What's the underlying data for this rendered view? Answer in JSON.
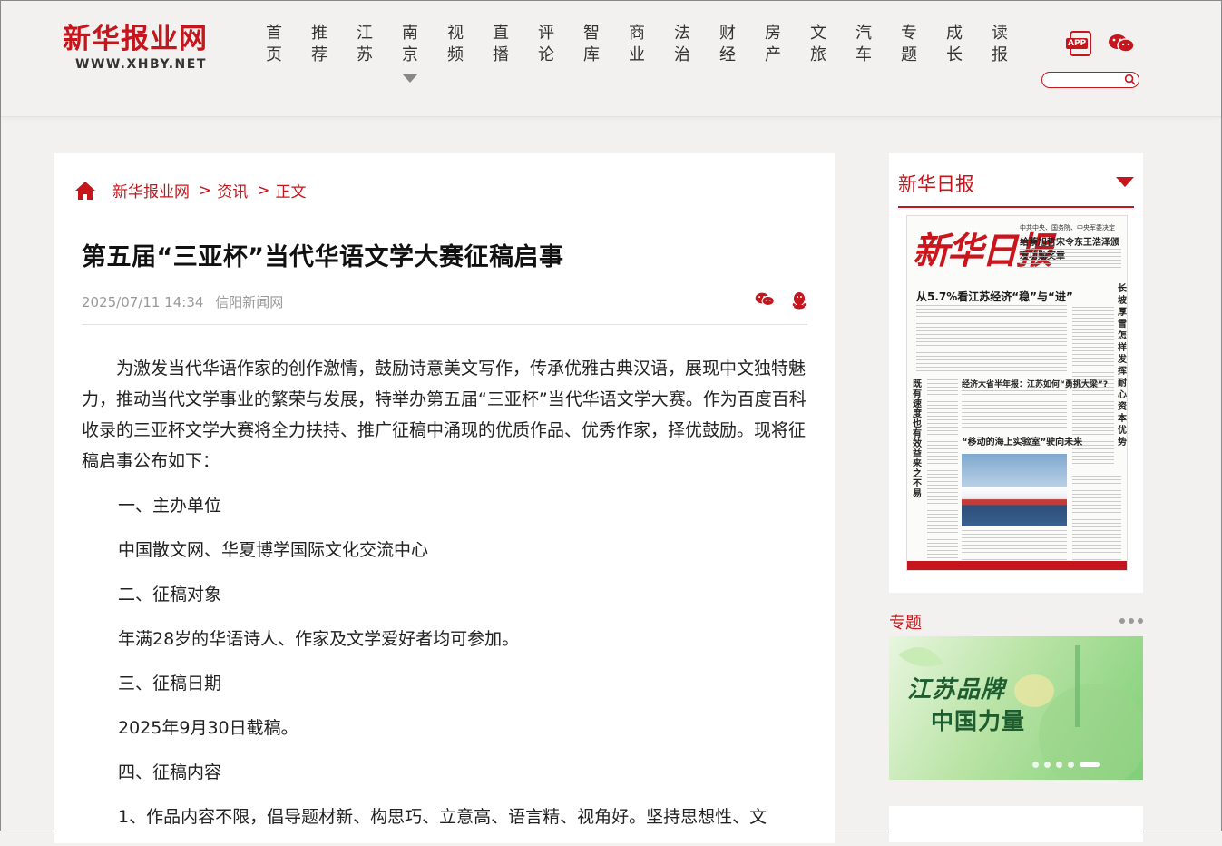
{
  "site": {
    "logo_cn": "新华报业网",
    "logo_en": "WWW.XHBY.NET"
  },
  "nav": [
    {
      "c1": "首",
      "c2": "页"
    },
    {
      "c1": "推",
      "c2": "荐"
    },
    {
      "c1": "江",
      "c2": "苏"
    },
    {
      "c1": "南",
      "c2": "京"
    },
    {
      "c1": "视",
      "c2": "频"
    },
    {
      "c1": "直",
      "c2": "播"
    },
    {
      "c1": "评",
      "c2": "论"
    },
    {
      "c1": "智",
      "c2": "库"
    },
    {
      "c1": "商",
      "c2": "业"
    },
    {
      "c1": "法",
      "c2": "治"
    },
    {
      "c1": "财",
      "c2": "经"
    },
    {
      "c1": "房",
      "c2": "产"
    },
    {
      "c1": "文",
      "c2": "旅"
    },
    {
      "c1": "汽",
      "c2": "车"
    },
    {
      "c1": "专",
      "c2": "题"
    },
    {
      "c1": "成",
      "c2": "长"
    },
    {
      "c1": "读",
      "c2": "报"
    }
  ],
  "header_icons": {
    "app_label": "APP"
  },
  "breadcrumb": {
    "home": "新华报业网",
    "sep1": ">",
    "section": "资讯",
    "sep2": ">",
    "current": "正文"
  },
  "article": {
    "title": "第五届“三亚杯”当代华语文学大赛征稿启事",
    "date": "2025/07/11 14:34",
    "source": "信阳新闻网",
    "intro": "为激发当代华语作家的创作激情，鼓励诗意美文写作，传承优雅古典汉语，展现中文独特魅力，推动当代文学事业的繁荣与发展，特举办第五届“三亚杯”当代华语文学大赛。作为百度百科收录的三亚杯文学大赛将全力扶持、推广征稿中涌现的优质作品、优秀作家，择优鼓励。现将征稿启事公布如下：",
    "s1_head": "一、主办单位",
    "s1_body": "中国散文网、华夏博学国际文化交流中心",
    "s2_head": "二、征稿对象",
    "s2_body": "年满28岁的华语诗人、作家及文学爱好者均可参加。",
    "s3_head": "三、征稿日期",
    "s3_body": "2025年9月30日截稿。",
    "s4_head": "四、征稿内容",
    "s4_body": "1、作品内容不限，倡导题材新、构思巧、立意高、语言精、视角好。坚持思想性、文"
  },
  "sidebar": {
    "paper_title": "新华日报",
    "paper": {
      "masthead": "新华日报",
      "top_line": "中共中央、国务院、中央军委决定",
      "top_head": "给蔡旭哲宋令东王浩泽颁发功勋奖章",
      "headline": "从5.7%看江苏经济“稳”与“进”",
      "mid_head": "经济大省半年报：江苏如何“勇挑大梁”?",
      "ship_head": "“移动的海上实验室”驶向未来",
      "left_vertical": "既有速度也有效益来之不易",
      "right_vertical": "长坡厚雪怎样发挥耐心资本优势?"
    },
    "topic_title": "专题",
    "banner_line1": "江苏品牌",
    "banner_line2": "中国力量"
  }
}
